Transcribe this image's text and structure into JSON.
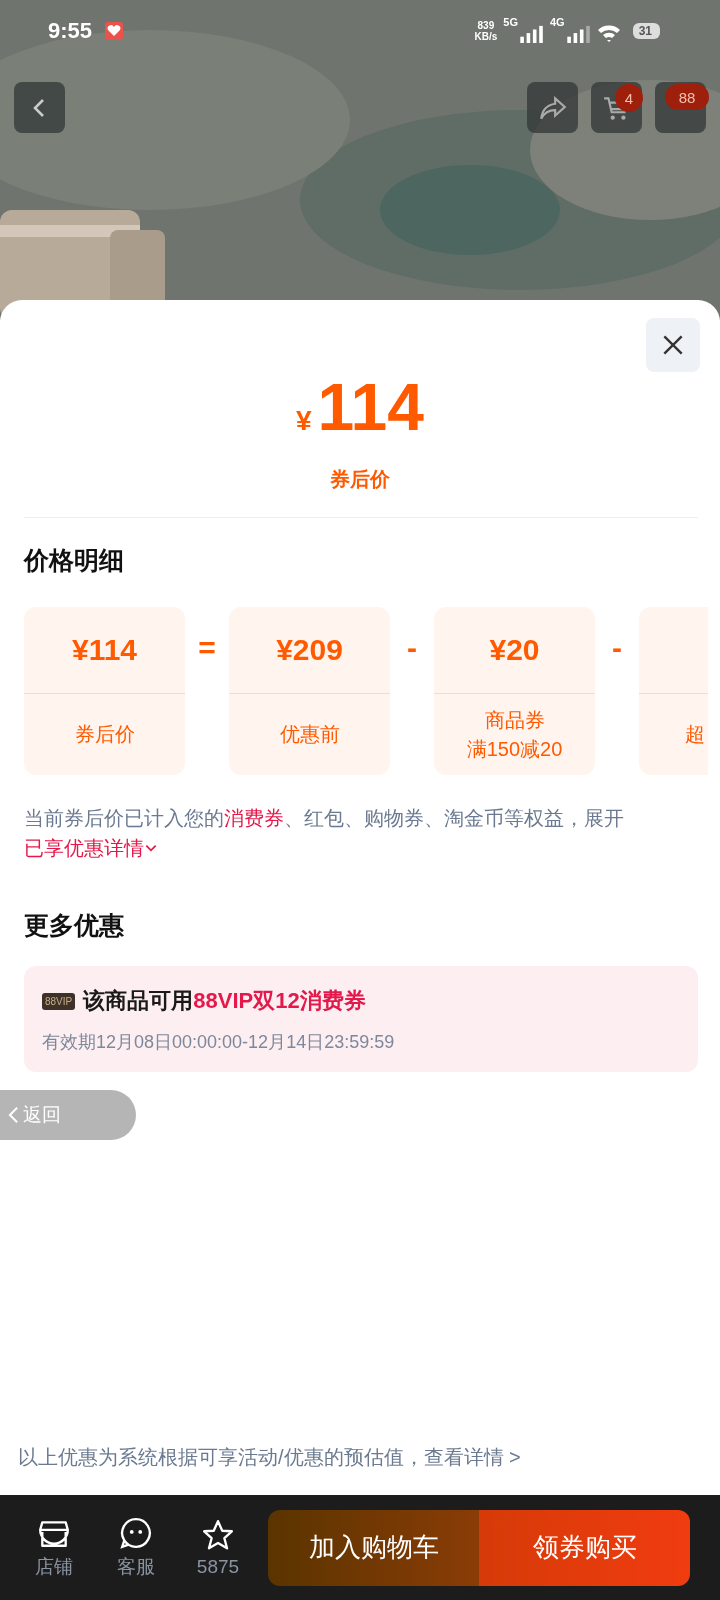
{
  "status_bar": {
    "time": "9:55",
    "speed": "839",
    "speed_unit": "KB/s",
    "network_1": "5G",
    "network_2": "4G",
    "battery": "31"
  },
  "top_bar": {
    "cart_badge": "4",
    "more_badge": "88"
  },
  "sheet": {
    "price_symbol": "¥",
    "price": "114",
    "price_label": "券后价"
  },
  "breakdown": {
    "title": "价格明细",
    "cards": [
      {
        "price": "¥114",
        "label": "券后价",
        "operator": "="
      },
      {
        "price": "¥209",
        "label": "优惠前",
        "operator": "-"
      },
      {
        "price": "¥20",
        "label": "商品券",
        "sublabel": "满150减20",
        "operator": "-"
      },
      {
        "label": "超"
      }
    ],
    "note": [
      {
        "text": "当前券后价已计入您的",
        "highlight": false
      },
      {
        "text": "消费券",
        "highlight": true
      },
      {
        "text": "、红包、购物券、淘金币等权益，展开",
        "highlight": false
      }
    ],
    "note_link": "已享优惠详情"
  },
  "more": {
    "title": "更多优惠",
    "badge": "88VIP",
    "coupon_title": [
      {
        "text": "该商品可用",
        "highlight": false
      },
      {
        "text": "88VIP双12消费券",
        "highlight": true
      }
    ],
    "validity": "有效期12月08日00:00:00-12月14日23:59:59"
  },
  "back_float": "返回",
  "footer_note": "以上优惠为系统根据可享活动/优惠的预估值，查看详情 >",
  "bottom_bar": {
    "items": [
      {
        "kind": "shop",
        "label": "店铺"
      },
      {
        "kind": "chat",
        "label": "客服"
      },
      {
        "kind": "star",
        "label": "5875"
      }
    ],
    "buttons": [
      {
        "kind": "cart",
        "label": "加入购物车"
      },
      {
        "kind": "buy",
        "label": "领券购买"
      }
    ]
  }
}
